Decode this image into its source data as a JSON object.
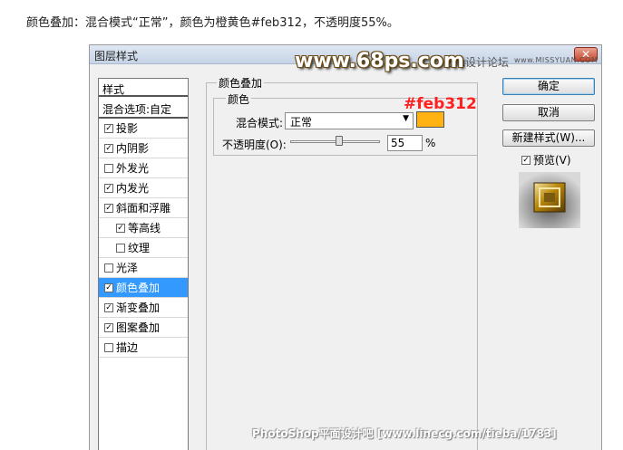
{
  "caption": "颜色叠加：混合模式“正常”，颜色为橙黄色#feb312，不透明度55%。",
  "dialog": {
    "title": "图层样式",
    "close_label": "✕"
  },
  "watermarks": {
    "site": "www.68ps.com",
    "forum": "思缘设计论坛",
    "url": "www.MISSYUAN.COM",
    "footer": "PhotoShop平面设计吧 [www.linecg.com/tieba/1783]"
  },
  "styles_panel": {
    "header": "样式",
    "blend_options": "混合选项:自定",
    "items": [
      {
        "label": "投影",
        "checked": true,
        "sub": false,
        "active": false
      },
      {
        "label": "内阴影",
        "checked": true,
        "sub": false,
        "active": false
      },
      {
        "label": "外发光",
        "checked": false,
        "sub": false,
        "active": false
      },
      {
        "label": "内发光",
        "checked": true,
        "sub": false,
        "active": false
      },
      {
        "label": "斜面和浮雕",
        "checked": true,
        "sub": false,
        "active": false
      },
      {
        "label": "等高线",
        "checked": true,
        "sub": true,
        "active": false
      },
      {
        "label": "纹理",
        "checked": false,
        "sub": true,
        "active": false
      },
      {
        "label": "光泽",
        "checked": false,
        "sub": false,
        "active": false
      },
      {
        "label": "颜色叠加",
        "checked": true,
        "sub": false,
        "active": true
      },
      {
        "label": "渐变叠加",
        "checked": true,
        "sub": false,
        "active": false
      },
      {
        "label": "图案叠加",
        "checked": true,
        "sub": false,
        "active": false
      },
      {
        "label": "描边",
        "checked": false,
        "sub": false,
        "active": false
      }
    ]
  },
  "overlay": {
    "group_title": "颜色叠加",
    "sub_group_title": "颜色",
    "blend_mode_label": "混合模式:",
    "blend_mode_value": "正常",
    "color_hex_annotation": "#feb312",
    "color": "#feb312",
    "opacity_label": "不透明度(O):",
    "opacity_value": "55",
    "opacity_unit": "%",
    "opacity_fraction": 0.55
  },
  "buttons": {
    "ok": "确定",
    "cancel": "取消",
    "new_style": "新建样式(W)...",
    "preview_label": "预览(V)",
    "preview_checked": true
  }
}
